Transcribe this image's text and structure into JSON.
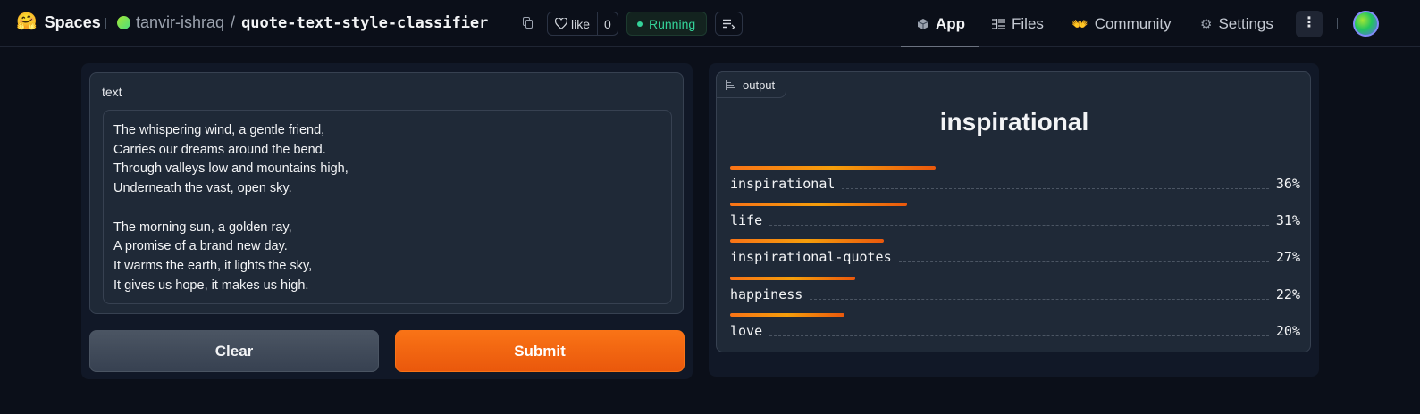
{
  "header": {
    "brand": "Spaces",
    "owner": "tanvir-ishraq",
    "repo_name": "quote-text-style-classifier",
    "like_label": "like",
    "like_count": "0",
    "status": "Running",
    "nav": [
      {
        "label": "App",
        "icon": "cube-icon",
        "active": true
      },
      {
        "label": "Files",
        "icon": "files-icon"
      },
      {
        "label": "Community",
        "icon": "community-icon"
      },
      {
        "label": "Settings",
        "icon": "gear-icon"
      }
    ],
    "more_label": "⋮"
  },
  "input": {
    "label": "text",
    "value": "The whispering wind, a gentle friend,\nCarries our dreams around the bend.\nThrough valleys low and mountains high,\nUnderneath the vast, open sky.\n\nThe morning sun, a golden ray,\nA promise of a brand new day.\nIt warms the earth, it lights the sky,\nIt gives us hope, it makes us high."
  },
  "buttons": {
    "clear": "Clear",
    "submit": "Submit"
  },
  "output": {
    "tag": "output",
    "top_label": "inspirational",
    "confidences": [
      {
        "label": "inspirational",
        "percent": "36%",
        "value": 0.36
      },
      {
        "label": "life",
        "percent": "31%",
        "value": 0.31
      },
      {
        "label": "inspirational-quotes",
        "percent": "27%",
        "value": 0.27
      },
      {
        "label": "happiness",
        "percent": "22%",
        "value": 0.22
      },
      {
        "label": "love",
        "percent": "20%",
        "value": 0.2
      }
    ]
  },
  "colors": {
    "accent": "#f97316",
    "status_green": "#34d399",
    "background": "#0b0f19"
  }
}
